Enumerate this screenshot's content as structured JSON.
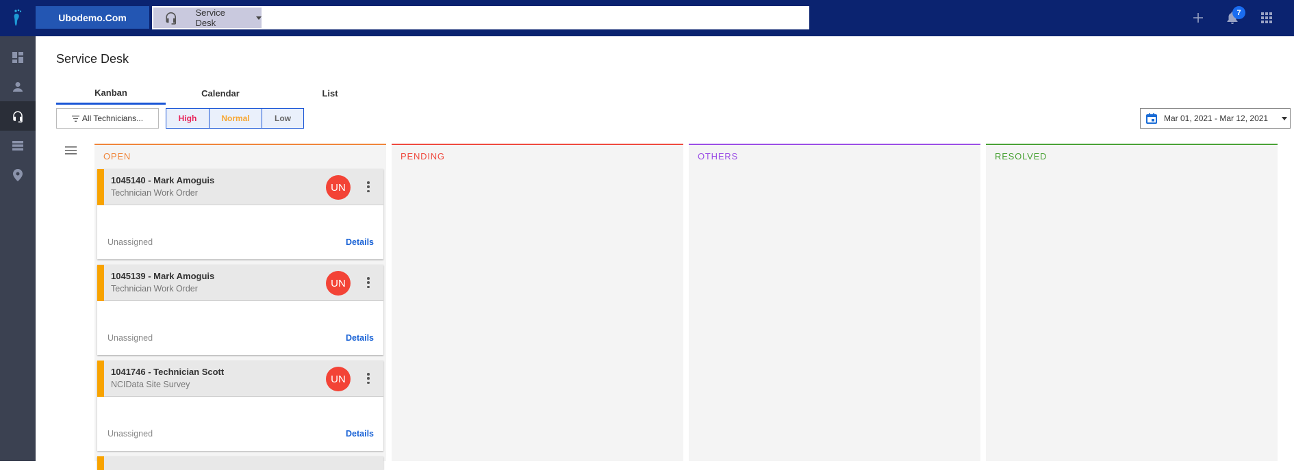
{
  "topbar": {
    "brand": "Ubodemo.Com",
    "module": "Service Desk",
    "search_placeholder": "",
    "notification_count": "7"
  },
  "leftnav": {
    "items": [
      {
        "name": "dashboard",
        "icon": "dashboard-icon",
        "active": false
      },
      {
        "name": "users",
        "icon": "person-icon",
        "active": false
      },
      {
        "name": "service-desk",
        "icon": "headset-icon",
        "active": true
      },
      {
        "name": "list",
        "icon": "list-icon",
        "active": false
      },
      {
        "name": "map",
        "icon": "location-pin-icon",
        "active": false
      }
    ]
  },
  "page": {
    "title": "Service Desk",
    "tabs": [
      {
        "label": "Kanban",
        "active": true
      },
      {
        "label": "Calendar",
        "active": false
      },
      {
        "label": "List",
        "active": false
      }
    ]
  },
  "filters": {
    "technicians": "All Technicians...",
    "priorities": [
      {
        "label": "High",
        "color": "#e8245a"
      },
      {
        "label": "Normal",
        "color": "#f7a733"
      },
      {
        "label": "Low",
        "color": "#666666"
      }
    ],
    "date_range": "Mar 01, 2021 - Mar 12, 2021"
  },
  "board": {
    "columns": [
      {
        "title": "OPEN",
        "color": "#f0853a"
      },
      {
        "title": "PENDING",
        "color": "#ef4a3f"
      },
      {
        "title": "OTHERS",
        "color": "#9b4ee6"
      },
      {
        "title": "RESOLVED",
        "color": "#4aa236"
      }
    ],
    "cards": [
      {
        "title": "1045140 - Mark Amoguis",
        "subtitle": "Technician Work Order",
        "avatar": "UN",
        "assignee": "Unassigned",
        "details": "Details"
      },
      {
        "title": "1045139 - Mark Amoguis",
        "subtitle": "Technician Work Order",
        "avatar": "UN",
        "assignee": "Unassigned",
        "details": "Details"
      },
      {
        "title": "1041746 - Technician Scott",
        "subtitle": "NCIData Site Survey",
        "avatar": "UN",
        "assignee": "Unassigned",
        "details": "Details"
      }
    ]
  }
}
